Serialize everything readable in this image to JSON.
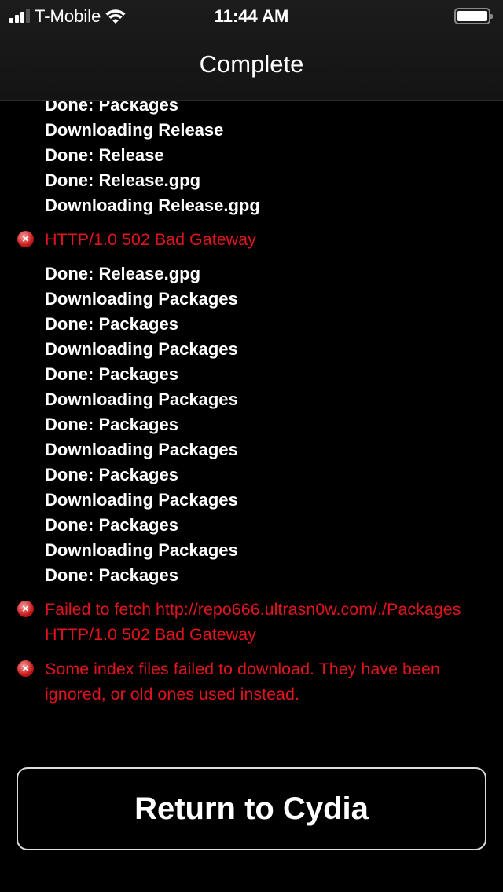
{
  "status_bar": {
    "carrier": "T-Mobile",
    "time": "11:44 AM",
    "signal_bars": 3,
    "battery_level": 1.0
  },
  "header": {
    "title": "Complete"
  },
  "log": [
    {
      "type": "info",
      "text": "Done: Packages"
    },
    {
      "type": "info",
      "text": "Downloading Release"
    },
    {
      "type": "info",
      "text": "Done: Release"
    },
    {
      "type": "info",
      "text": "Done: Release.gpg"
    },
    {
      "type": "info",
      "text": "Downloading Release.gpg"
    },
    {
      "type": "error",
      "text": "HTTP/1.0 502 Bad Gateway"
    },
    {
      "type": "info",
      "text": "Done: Release.gpg"
    },
    {
      "type": "info",
      "text": "Downloading Packages"
    },
    {
      "type": "info",
      "text": "Done: Packages"
    },
    {
      "type": "info",
      "text": "Downloading Packages"
    },
    {
      "type": "info",
      "text": "Done: Packages"
    },
    {
      "type": "info",
      "text": "Downloading Packages"
    },
    {
      "type": "info",
      "text": "Done: Packages"
    },
    {
      "type": "info",
      "text": "Downloading Packages"
    },
    {
      "type": "info",
      "text": "Done: Packages"
    },
    {
      "type": "info",
      "text": "Downloading Packages"
    },
    {
      "type": "info",
      "text": "Done: Packages"
    },
    {
      "type": "info",
      "text": "Downloading Packages"
    },
    {
      "type": "info",
      "text": "Done: Packages"
    },
    {
      "type": "error",
      "text": "Failed to fetch http://repo666.ultrasn0w.com/./Packages HTTP/1.0 502 Bad Gateway"
    },
    {
      "type": "error",
      "text": "Some index files failed to download. They have been ignored, or old ones used instead."
    }
  ],
  "colors": {
    "error": "#e0141e",
    "background": "#000000"
  },
  "icons": {
    "error": "error-x-circle-icon"
  },
  "return_button": {
    "label": "Return to Cydia"
  }
}
